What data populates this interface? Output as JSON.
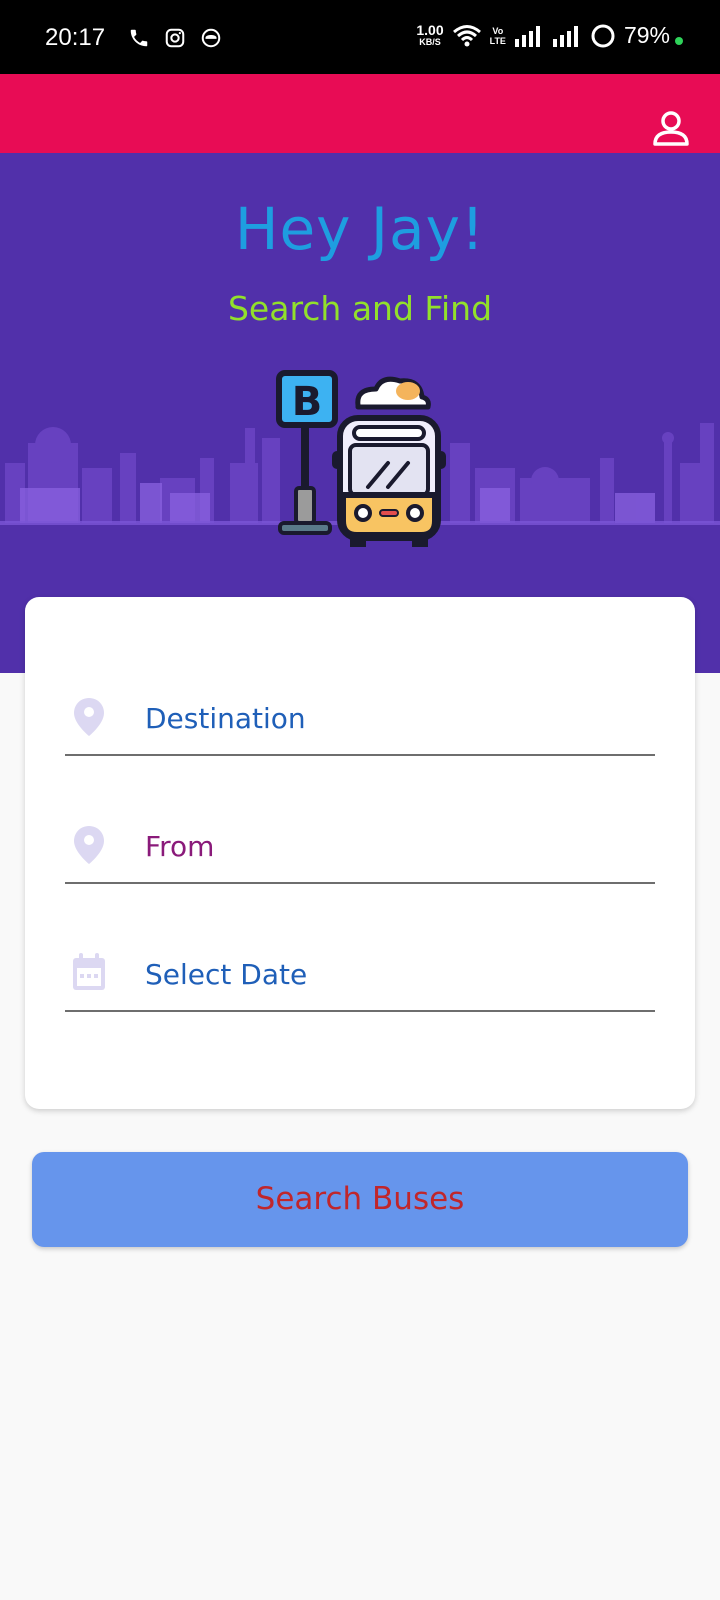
{
  "status_bar": {
    "time": "20:17",
    "net_speed_value": "1.00",
    "net_speed_unit": "KB/S",
    "lte_top": "Vo",
    "lte_bottom": "LTE",
    "battery": "79%"
  },
  "app_bar": {
    "profile_icon": "person-outline-icon",
    "bg_color": "#e80c55"
  },
  "hero": {
    "greeting": "Hey Jay!",
    "subtitle": "Search and Find",
    "bus_stop_letter": "B",
    "bg_color": "#5130aa"
  },
  "form": {
    "destination_label": "Destination",
    "from_label": "From",
    "date_label": "Select Date",
    "destination_color": "#1f5fb8",
    "from_color": "#8a1a7a",
    "date_color": "#1f5fb8"
  },
  "search_button": {
    "label": "Search Buses",
    "bg_color": "#6695ec",
    "text_color": "#c0262b"
  }
}
